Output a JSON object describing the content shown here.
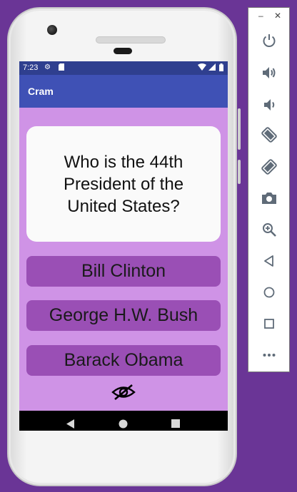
{
  "status_bar": {
    "time": "7:23"
  },
  "app_bar": {
    "title": "Cram"
  },
  "flashcard": {
    "question": "Who is the 44th President of the United States?"
  },
  "answers": [
    {
      "label": "Bill Clinton"
    },
    {
      "label": "George H.W. Bush"
    },
    {
      "label": "Barack Obama"
    }
  ],
  "colors": {
    "screen_background": "#cf93e6",
    "answer_background": "#9a4fb5",
    "app_bar": "#3f51b5",
    "status_bar": "#2f3f8f",
    "page_background": "#6a3596"
  },
  "emulator_controls": {
    "window_buttons": [
      "minimize-icon",
      "close-icon"
    ],
    "tools": [
      "power-icon",
      "volume-up-icon",
      "volume-down-icon",
      "rotate-left-icon",
      "rotate-right-icon",
      "camera-icon",
      "zoom-icon",
      "back-icon",
      "home-icon",
      "overview-icon",
      "more-icon"
    ]
  }
}
